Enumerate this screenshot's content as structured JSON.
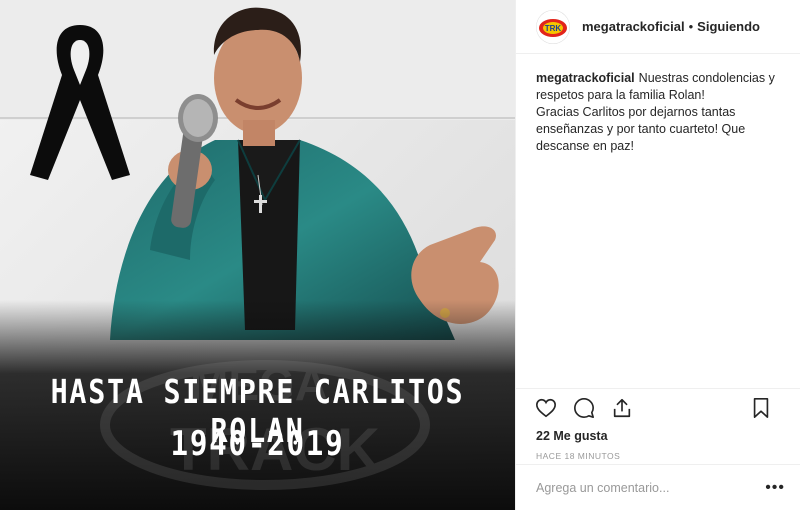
{
  "post": {
    "image": {
      "overlay_name": "HASTA SIEMPRE CARLITOS ROLAN",
      "overlay_years": "1940-2019",
      "icons": [
        "mourning-ribbon",
        "microphone",
        "mega-track-watermark"
      ]
    },
    "header": {
      "username": "megatrackoficial",
      "separator": "•",
      "follow_status": "Siguiendo",
      "avatar_icon": "mega-track-logo",
      "brand_color": "#e2241b"
    },
    "caption": {
      "username": "megatrackoficial",
      "text_line1": "Nuestras condolencias y respetos para la familia Rolan!",
      "text_line2": "Gracias Carlitos por dejarnos tantas enseñanzas y por tanto cuarteto! Que descanse en paz!"
    },
    "actions": {
      "icons": [
        "heart-icon",
        "comment-icon",
        "share-icon",
        "bookmark-icon"
      ],
      "likes": "22 Me gusta",
      "timestamp": "HACE 18 MINUTOS"
    },
    "comment_box": {
      "placeholder": "Agrega un comentario...",
      "more": "•••"
    }
  }
}
